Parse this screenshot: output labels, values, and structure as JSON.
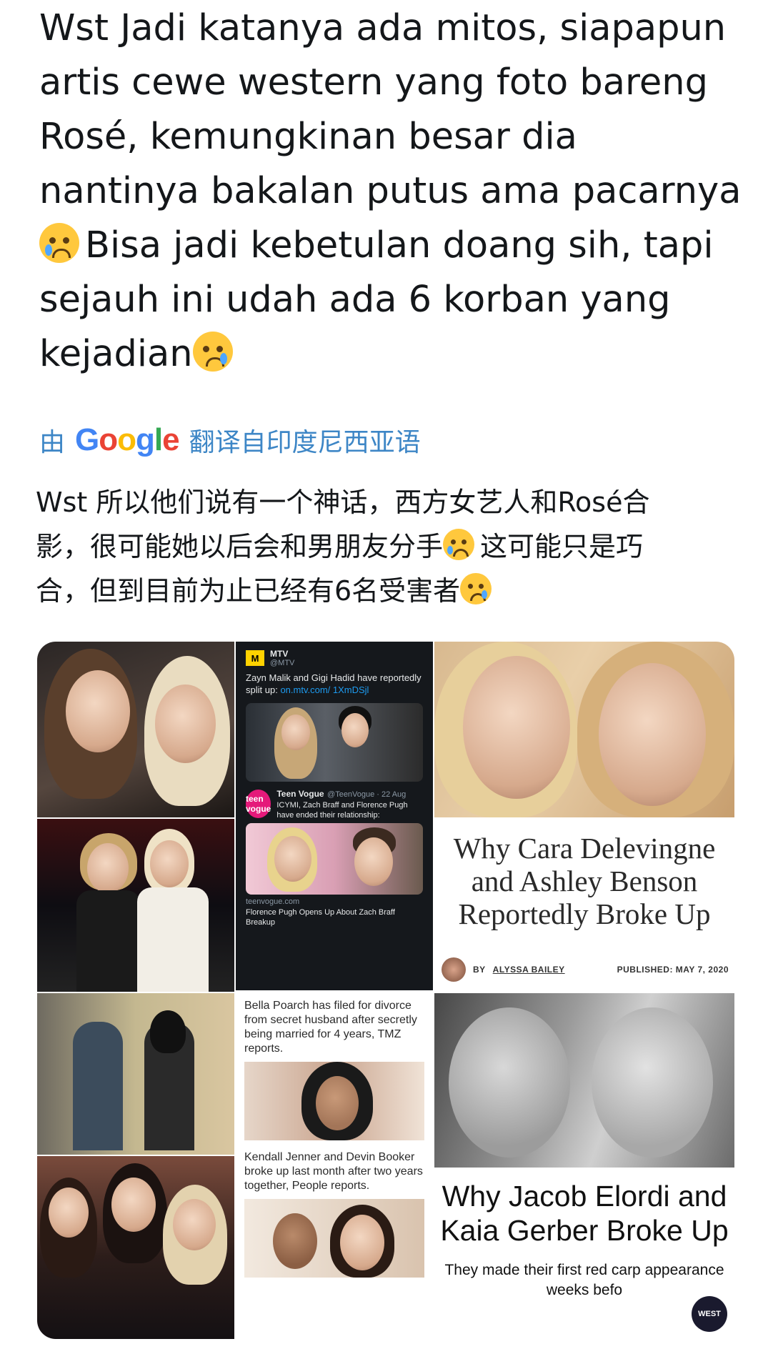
{
  "post": {
    "lines": [
      "Wst Jadi katanya ada mitos, siapapun",
      "artis cewe western yang foto bareng",
      "Rosé, kemungkinan besar dia",
      "nantinya bakalan putus ama pacarnya"
    ],
    "line5": "Bisa jadi kebetulan doang sih, tapi",
    "line6": "sejauh ini udah ada 6 korban yang",
    "line7": "kejadian"
  },
  "translation": {
    "prefix": "由",
    "brand": "Google",
    "suffix": "翻译自印度尼西亚语",
    "text1": "Wst 所以他们说有一个神话，西方女艺人和Rosé合",
    "text2": "影，很可能她以后会和男朋友分手",
    "text2b": "这可能只是巧",
    "text3": "合，但到目前为止已经有6名受害者"
  },
  "collage": {
    "mtv_tweet": {
      "name": "MTV",
      "handle": "@MTV",
      "text": "Zayn Malik and Gigi Hadid have reportedly split up:",
      "link": "on.mtv.com/ 1XmDSjl"
    },
    "teenvogue_tweet": {
      "name": "Teen Vogue",
      "handle": "@TeenVogue · 22 Aug",
      "text": "ICYMI, Zach Braff and Florence Pugh have ended their relationship:",
      "domain": "teenvogue.com",
      "caption": "Florence Pugh Opens Up About Zach Braff Breakup"
    },
    "news1": "Bella Poarch has filed for divorce from secret husband after secretly being married for 4 years, TMZ reports.",
    "news2": "Kendall Jenner and Devin Booker broke up last month after two years together, People reports.",
    "article1": {
      "title": "Why Cara Delevingne and Ashley Benson Reportedly Broke Up",
      "by": "BY",
      "author": "ALYSSA BAILEY",
      "published": "PUBLISHED: MAY 7, 2020"
    },
    "article2": {
      "title": "Why Jacob Elordi and Kaia Gerber Broke Up",
      "sub": "They made their first red carp appearance weeks befo",
      "badge": "WEST"
    },
    "logo_text": {
      "mtv": "M",
      "teen_vogue": "teen vogue"
    }
  }
}
